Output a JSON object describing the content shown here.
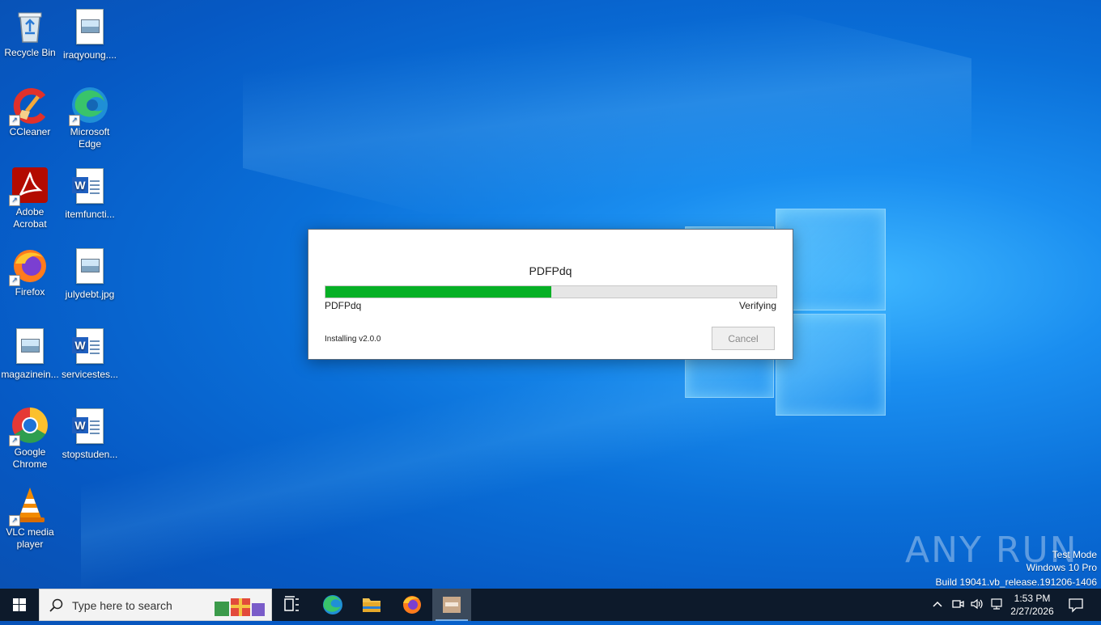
{
  "desktop_icons": [
    {
      "label": "Recycle Bin"
    },
    {
      "label": "iraqyoung...."
    },
    {
      "label": "CCleaner"
    },
    {
      "label": "Microsoft Edge"
    },
    {
      "label": "Adobe Acrobat"
    },
    {
      "label": "itemfuncti..."
    },
    {
      "label": "Firefox"
    },
    {
      "label": "julydebt.jpg"
    },
    {
      "label": "magazinein..."
    },
    {
      "label": "servicestes..."
    },
    {
      "label": "Google Chrome"
    },
    {
      "label": "stopstuden..."
    },
    {
      "label": "VLC media player"
    }
  ],
  "installer": {
    "title": "PDFPdq",
    "progress_fraction": 0.5,
    "left_label": "PDFPdq",
    "right_label": "Verifying",
    "status": "Installing v2.0.0",
    "cancel_label": "Cancel"
  },
  "watermark": {
    "brand": "ANY RUN",
    "line1": "Test Mode",
    "line2": "Windows 10 Pro",
    "line3": "Build 19041.vb_release.191206-1406"
  },
  "taskbar": {
    "search_placeholder": "Type here to search",
    "apps": [
      "task-view",
      "edge",
      "file-explorer",
      "firefox",
      "installer"
    ],
    "time": "1:53 PM",
    "date": "2/27/2026"
  },
  "colors": {
    "progress_fill": "#06b025",
    "taskbar": "#0d1a2b",
    "desktop_blue": "#0a6fd8"
  }
}
